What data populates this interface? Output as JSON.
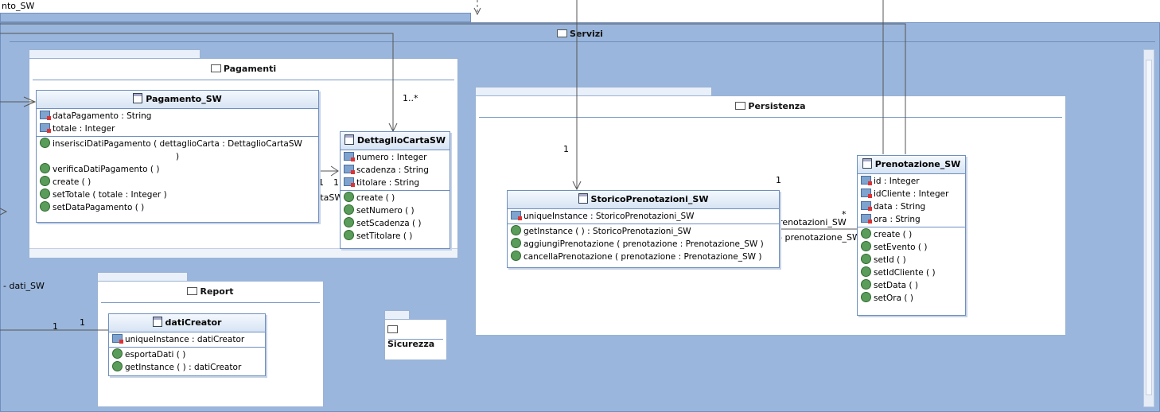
{
  "top_fragment_label": "nto_SW",
  "left_labels": {
    "dati_sw": "- dati_SW"
  },
  "packages": {
    "servizi": "Servizi",
    "pagamenti": "Pagamenti",
    "persistenza": "Persistenza",
    "report": "Report",
    "sicurezza": "Sicurezza"
  },
  "classes": {
    "pagamento": {
      "name": "Pagamento_SW",
      "attributes": [
        "dataPagamento : String",
        "totale : Integer"
      ],
      "operations": [
        "inserisciDatiPagamento ( dettaglioCarta : DettaglioCartaSW",
        ")",
        "verificaDatiPagamento ( )",
        "create ( )",
        "setTotale ( totale : Integer )",
        "setDataPagamento ( )"
      ]
    },
    "dettaglio": {
      "name": "DettaglioCartaSW",
      "attributes": [
        "numero : Integer",
        "scadenza : String",
        "titolare : String"
      ],
      "operations": [
        "create ( )",
        "setNumero ( )",
        "setScadenza ( )",
        "setTitolare ( )"
      ]
    },
    "storico": {
      "name": "StoricoPrenotazioni_SW",
      "attributes": [
        "uniqueInstance : StoricoPrenotazioni_SW"
      ],
      "operations": [
        "getInstance ( ) : StoricoPrenotazioni_SW",
        "aggiungiPrenotazione ( prenotazione : Prenotazione_SW )",
        "cancellaPrenotazione ( prenotazione : Prenotazione_SW )"
      ]
    },
    "prenotazione": {
      "name": "Prenotazione_SW",
      "attributes": [
        "id : Integer",
        "idCliente : Integer",
        "data : String",
        "ora : String"
      ],
      "operations": [
        "create ( )",
        "setEvento ( )",
        "setId ( )",
        "setIdCliente ( )",
        "setData ( )",
        "setOra ( )"
      ]
    },
    "daticreator": {
      "name": "datiCreator",
      "attributes": [
        "uniqueInstance : datiCreator"
      ],
      "operations": [
        "esportaDati ( )",
        "getInstance ( ) : datiCreator"
      ]
    }
  },
  "associations": {
    "mult_1_star": "1..*",
    "dettaglio_role": "- dettaglioCartaSW",
    "dettaglio_m1": "1",
    "dettaglio_m2": "1",
    "storico_m1": "1",
    "persist_m1": "1",
    "storico_role": "- storicoPrenotazioni_SW",
    "storico_star": "*",
    "prenotazione_role": "- prenotazione_SW",
    "report_m1": "1",
    "report_m2": "1"
  },
  "colors": {
    "package_fill": "#9ab6dc",
    "package_border": "#6f8fbf",
    "class_border": "#6f8fbf"
  }
}
